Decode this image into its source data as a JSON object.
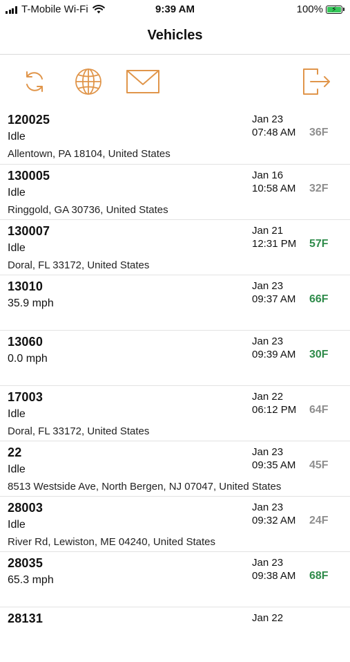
{
  "status_bar": {
    "carrier": "T-Mobile Wi-Fi",
    "time": "9:39 AM",
    "battery": "100%",
    "battery_level": 1.0
  },
  "header": {
    "title": "Vehicles"
  },
  "toolbar": {
    "icons": [
      "refresh-icon",
      "globe-icon",
      "mail-icon",
      "logout-icon"
    ],
    "accent_color": "#e0954a"
  },
  "colors": {
    "temp_active": "#2e8b4a",
    "temp_inactive": "#8e8e8e"
  },
  "vehicles": [
    {
      "id": "120025",
      "status": "Idle",
      "address": "Allentown, PA 18104, United States",
      "date": "Jan 23",
      "time": "07:48 AM",
      "temp": "36F",
      "temp_state": "gray"
    },
    {
      "id": "130005",
      "status": "Idle",
      "address": "Ringgold, GA 30736, United States",
      "date": "Jan 16",
      "time": "10:58 AM",
      "temp": "32F",
      "temp_state": "gray"
    },
    {
      "id": "130007",
      "status": "Idle",
      "address": "Doral, FL 33172, United States",
      "date": "Jan 21",
      "time": "12:31 PM",
      "temp": "57F",
      "temp_state": "green"
    },
    {
      "id": "13010",
      "status": "35.9 mph",
      "address": "",
      "date": "Jan 23",
      "time": "09:37 AM",
      "temp": "66F",
      "temp_state": "green"
    },
    {
      "id": "13060",
      "status": "0.0 mph",
      "address": "",
      "date": "Jan 23",
      "time": "09:39 AM",
      "temp": "30F",
      "temp_state": "green"
    },
    {
      "id": "17003",
      "status": "Idle",
      "address": "Doral, FL 33172, United States",
      "date": "Jan 22",
      "time": "06:12 PM",
      "temp": "64F",
      "temp_state": "gray"
    },
    {
      "id": "22",
      "status": "Idle",
      "address": "8513 Westside Ave, North Bergen, NJ 07047, United States",
      "date": "Jan 23",
      "time": "09:35 AM",
      "temp": "45F",
      "temp_state": "gray"
    },
    {
      "id": "28003",
      "status": "Idle",
      "address": "River Rd, Lewiston, ME 04240, United States",
      "date": "Jan 23",
      "time": "09:32 AM",
      "temp": "24F",
      "temp_state": "gray"
    },
    {
      "id": "28035",
      "status": "65.3 mph",
      "address": "",
      "date": "Jan 23",
      "time": "09:38 AM",
      "temp": "68F",
      "temp_state": "green"
    },
    {
      "id": "28131",
      "status": "",
      "address": "",
      "date": "Jan 22",
      "time": "",
      "temp": "",
      "temp_state": "gray"
    }
  ]
}
